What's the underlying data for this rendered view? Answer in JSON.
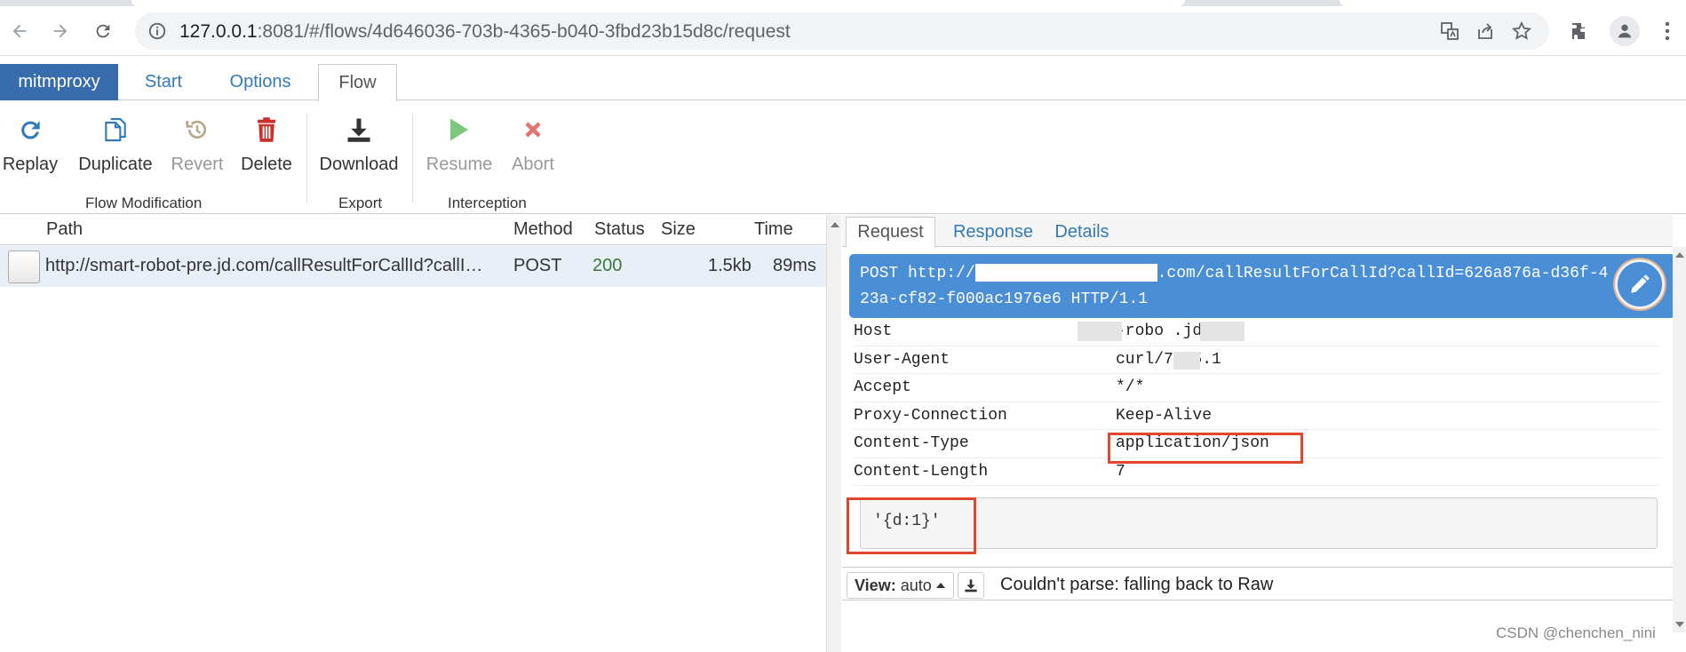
{
  "browser": {
    "url_host": "127.0.0.1",
    "url_rest": ":8081/#/flows/4d646036-703b-4365-b040-3fbd23b15d8c/request",
    "icons": [
      "back-icon",
      "forward-icon",
      "reload-icon",
      "info-icon",
      "translate-icon",
      "share-icon",
      "star-icon",
      "extensions-icon",
      "profile-icon",
      "menu-icon"
    ]
  },
  "app": {
    "brand": "mitmproxy",
    "tabs": [
      "Start",
      "Options",
      "Flow"
    ],
    "active_tab": "Flow"
  },
  "ribbon": {
    "buttons": {
      "replay": "Replay",
      "duplicate": "Duplicate",
      "revert": "Revert",
      "delete": "Delete",
      "download": "Download",
      "resume": "Resume",
      "abort": "Abort"
    },
    "groups": {
      "flow_modification": "Flow Modification",
      "export": "Export",
      "interception": "Interception"
    },
    "colors": {
      "primary": "#337ab7",
      "delete": "#c9302c",
      "resume": "#5cb85c",
      "abort": "#d9534f"
    }
  },
  "flow_table": {
    "columns": {
      "path": "Path",
      "method": "Method",
      "status": "Status",
      "size": "Size",
      "time": "Time"
    },
    "rows": [
      {
        "path": "http://smart-robot-pre.jd.com/callResultForCallId?callI…",
        "method": "POST",
        "status": "200",
        "size": "1.5kb",
        "time": "89ms"
      }
    ]
  },
  "detail": {
    "tabs": [
      "Request",
      "Response",
      "Details"
    ],
    "active_tab": "Request",
    "request_line_start": "POST http://",
    "request_line_end": ".com/callResultForCallId?callId=626a876a-d36f-4",
    "request_line_2": "23a-cf82-f000ac1976e6 HTTP/1.1",
    "headers": [
      {
        "name": "Host",
        "value": "-robo        .jd.com"
      },
      {
        "name": "User-Agent",
        "value": "curl/7.55.1"
      },
      {
        "name": "Accept",
        "value": "*/*"
      },
      {
        "name": "Proxy-Connection",
        "value": "Keep-Alive"
      },
      {
        "name": "Content-Type",
        "value": "application/json"
      },
      {
        "name": "Content-Length",
        "value": "7"
      }
    ],
    "body": "'{d:1}'",
    "view_label": "View:",
    "view_value": "auto",
    "parse_message": "Couldn't parse: falling back to Raw"
  },
  "watermark": "CSDN @chenchen_nini"
}
